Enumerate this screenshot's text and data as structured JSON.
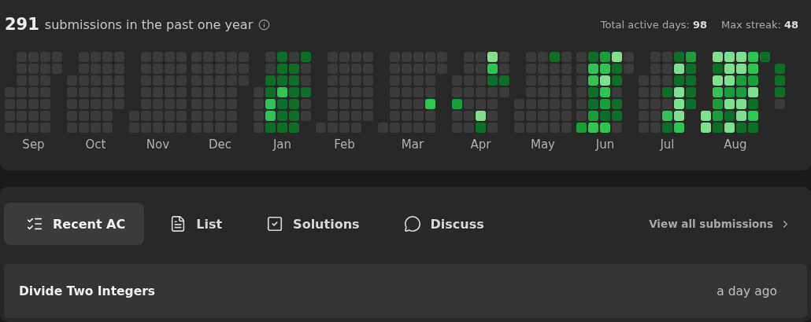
{
  "heatmap": {
    "count": "291",
    "caption": "submissions in the past one year",
    "stats": [
      {
        "label": "Total active days:",
        "value": "98"
      },
      {
        "label": "Max streak:",
        "value": "48"
      }
    ],
    "months": [
      {
        "label": "Sep",
        "weeks": [
          [
            {
              "kind": "gap"
            },
            {
              "kind": "gap"
            },
            {
              "kind": "gap"
            },
            {
              "color": "#3b3b3b"
            },
            {
              "color": "#3b3b3b"
            },
            {
              "color": "#3b3b3b"
            },
            {
              "color": "#3b3b3b"
            }
          ],
          [
            {
              "color": "#3b3b3b"
            },
            {
              "color": "#3b3b3b"
            },
            {
              "color": "#3b3b3b"
            },
            {
              "color": "#3b3b3b"
            },
            {
              "color": "#3b3b3b"
            },
            {
              "color": "#3b3b3b"
            },
            {
              "color": "#3b3b3b"
            }
          ],
          [
            {
              "color": "#3b3b3b"
            },
            {
              "color": "#3b3b3b"
            },
            {
              "color": "#3b3b3b"
            },
            {
              "color": "#3b3b3b"
            },
            {
              "color": "#3b3b3b"
            },
            {
              "color": "#3b3b3b"
            },
            {
              "color": "#3b3b3b"
            }
          ],
          [
            {
              "color": "#3b3b3b"
            },
            {
              "color": "#3b3b3b"
            },
            {
              "color": "#3b3b3b"
            },
            {
              "color": "#3b3b3b"
            },
            {
              "color": "#3b3b3b"
            },
            {
              "color": "#3b3b3b"
            },
            {
              "color": "#3b3b3b"
            }
          ],
          [
            {
              "color": "#3b3b3b"
            },
            {
              "color": "#3b3b3b"
            }
          ]
        ]
      },
      {
        "label": "Oct",
        "weeks": [
          [
            {
              "kind": "gap"
            },
            {
              "kind": "gap"
            },
            {
              "color": "#3b3b3b"
            },
            {
              "color": "#3b3b3b"
            },
            {
              "color": "#3b3b3b"
            },
            {
              "color": "#3b3b3b"
            },
            {
              "color": "#3b3b3b"
            }
          ],
          [
            {
              "color": "#3b3b3b"
            },
            {
              "color": "#3b3b3b"
            },
            {
              "color": "#3b3b3b"
            },
            {
              "color": "#3b3b3b"
            },
            {
              "color": "#3b3b3b"
            },
            {
              "color": "#3b3b3b"
            },
            {
              "color": "#3b3b3b"
            }
          ],
          [
            {
              "color": "#3b3b3b"
            },
            {
              "color": "#3b3b3b"
            },
            {
              "color": "#3b3b3b"
            },
            {
              "color": "#3b3b3b"
            },
            {
              "color": "#3b3b3b"
            },
            {
              "color": "#3b3b3b"
            },
            {
              "color": "#3b3b3b"
            }
          ],
          [
            {
              "color": "#3b3b3b"
            },
            {
              "color": "#3b3b3b"
            },
            {
              "color": "#3b3b3b"
            },
            {
              "color": "#3b3b3b"
            },
            {
              "color": "#3b3b3b"
            },
            {
              "color": "#3b3b3b"
            },
            {
              "color": "#3b3b3b"
            }
          ],
          [
            {
              "color": "#3b3b3b"
            },
            {
              "color": "#3b3b3b"
            },
            {
              "color": "#3b3b3b"
            },
            {
              "color": "#3b3b3b"
            },
            {
              "color": "#3b3b3b"
            }
          ]
        ]
      },
      {
        "label": "Nov",
        "weeks": [
          [
            {
              "kind": "gap"
            },
            {
              "kind": "gap"
            },
            {
              "kind": "gap"
            },
            {
              "kind": "gap"
            },
            {
              "kind": "gap"
            },
            {
              "color": "#3b3b3b"
            },
            {
              "color": "#3b3b3b"
            }
          ],
          [
            {
              "color": "#3b3b3b"
            },
            {
              "color": "#3b3b3b"
            },
            {
              "color": "#3b3b3b"
            },
            {
              "color": "#3b3b3b"
            },
            {
              "color": "#3b3b3b"
            },
            {
              "color": "#3b3b3b"
            },
            {
              "color": "#3b3b3b"
            }
          ],
          [
            {
              "color": "#3b3b3b"
            },
            {
              "color": "#3b3b3b"
            },
            {
              "color": "#3b3b3b"
            },
            {
              "color": "#3b3b3b"
            },
            {
              "color": "#3b3b3b"
            },
            {
              "color": "#3b3b3b"
            },
            {
              "color": "#3b3b3b"
            }
          ],
          [
            {
              "color": "#3b3b3b"
            },
            {
              "color": "#3b3b3b"
            },
            {
              "color": "#3b3b3b"
            },
            {
              "color": "#3b3b3b"
            },
            {
              "color": "#3b3b3b"
            },
            {
              "color": "#3b3b3b"
            },
            {
              "color": "#3b3b3b"
            }
          ],
          [
            {
              "color": "#3b3b3b"
            },
            {
              "color": "#3b3b3b"
            },
            {
              "color": "#3b3b3b"
            },
            {
              "color": "#3b3b3b"
            },
            {
              "color": "#3b3b3b"
            },
            {
              "color": "#3b3b3b"
            },
            {
              "color": "#3b3b3b"
            }
          ]
        ]
      },
      {
        "label": "Dec",
        "weeks": [
          [
            {
              "color": "#3b3b3b"
            },
            {
              "color": "#3b3b3b"
            },
            {
              "color": "#3b3b3b"
            },
            {
              "color": "#3b3b3b"
            },
            {
              "color": "#3b3b3b"
            },
            {
              "color": "#3b3b3b"
            },
            {
              "color": "#3b3b3b"
            }
          ],
          [
            {
              "color": "#3b3b3b"
            },
            {
              "color": "#3b3b3b"
            },
            {
              "color": "#3b3b3b"
            },
            {
              "color": "#3b3b3b"
            },
            {
              "color": "#3b3b3b"
            },
            {
              "color": "#3b3b3b"
            },
            {
              "color": "#3b3b3b"
            }
          ],
          [
            {
              "color": "#3b3b3b"
            },
            {
              "color": "#3b3b3b"
            },
            {
              "color": "#3b3b3b"
            },
            {
              "color": "#3b3b3b"
            },
            {
              "color": "#3b3b3b"
            },
            {
              "color": "#3b3b3b"
            },
            {
              "color": "#3b3b3b"
            }
          ],
          [
            {
              "color": "#3b3b3b"
            },
            {
              "color": "#3b3b3b"
            },
            {
              "color": "#3b3b3b"
            },
            {
              "color": "#3b3b3b"
            },
            {
              "color": "#3b3b3b"
            },
            {
              "color": "#3b3b3b"
            },
            {
              "color": "#3b3b3b"
            }
          ],
          [
            {
              "color": "#3b3b3b"
            },
            {
              "color": "#3b3b3b"
            },
            {
              "color": "#3b3b3b"
            }
          ]
        ]
      },
      {
        "label": "Jan",
        "weeks": [
          [
            {
              "kind": "gap"
            },
            {
              "kind": "gap"
            },
            {
              "kind": "gap"
            },
            {
              "color": "#3b3b3b"
            },
            {
              "color": "#3b3b3b"
            },
            {
              "color": "#3b3b3b"
            },
            {
              "color": "#3b3b3b"
            }
          ],
          [
            {
              "color": "#3b3b3b"
            },
            {
              "color": "#3b3b3b"
            },
            {
              "color": "#0d6e27"
            },
            {
              "color": "#0d6e27"
            },
            {
              "color": "#2fc453"
            },
            {
              "color": "#2fc453"
            },
            {
              "color": "#0d6e27"
            }
          ],
          [
            {
              "color": "#0d6e27"
            },
            {
              "color": "#0d6e27"
            },
            {
              "color": "#0d6e27"
            },
            {
              "color": "#2fc453"
            },
            {
              "color": "#0d6e27"
            },
            {
              "color": "#0d6e27"
            },
            {
              "color": "#0d6e27"
            }
          ],
          [
            {
              "color": "#3b3b3b"
            },
            {
              "color": "#0d6e27"
            },
            {
              "color": "#0d6e27"
            },
            {
              "color": "#0d6e27"
            },
            {
              "color": "#0d6e27"
            },
            {
              "color": "#0d6e27"
            },
            {
              "color": "#0d6e27"
            }
          ],
          [
            {
              "color": "#0d6e27"
            },
            {
              "color": "#3b3b3b"
            },
            {
              "color": "#3b3b3b"
            },
            {
              "color": "#0d6e27"
            },
            {
              "color": "#3b3b3b"
            },
            {
              "color": "#3b3b3b"
            }
          ]
        ]
      },
      {
        "label": "Feb",
        "weeks": [
          [
            {
              "kind": "gap"
            },
            {
              "kind": "gap"
            },
            {
              "kind": "gap"
            },
            {
              "kind": "gap"
            },
            {
              "kind": "gap"
            },
            {
              "kind": "gap"
            },
            {
              "color": "#3b3b3b"
            }
          ],
          [
            {
              "color": "#3b3b3b"
            },
            {
              "color": "#3b3b3b"
            },
            {
              "color": "#3b3b3b"
            },
            {
              "color": "#3b3b3b"
            },
            {
              "color": "#3b3b3b"
            },
            {
              "color": "#3b3b3b"
            },
            {
              "color": "#3b3b3b"
            }
          ],
          [
            {
              "color": "#3b3b3b"
            },
            {
              "color": "#3b3b3b"
            },
            {
              "color": "#3b3b3b"
            },
            {
              "color": "#3b3b3b"
            },
            {
              "color": "#3b3b3b"
            },
            {
              "color": "#3b3b3b"
            },
            {
              "color": "#3b3b3b"
            }
          ],
          [
            {
              "color": "#3b3b3b"
            },
            {
              "color": "#3b3b3b"
            },
            {
              "color": "#3b3b3b"
            },
            {
              "color": "#3b3b3b"
            },
            {
              "color": "#3b3b3b"
            },
            {
              "color": "#3b3b3b"
            },
            {
              "color": "#3b3b3b"
            }
          ],
          [
            {
              "color": "#3b3b3b"
            },
            {
              "color": "#3b3b3b"
            },
            {
              "color": "#3b3b3b"
            },
            {
              "color": "#3b3b3b"
            },
            {
              "color": "#3b3b3b"
            },
            {
              "color": "#3b3b3b"
            }
          ]
        ]
      },
      {
        "label": "Mar",
        "weeks": [
          [
            {
              "kind": "gap"
            },
            {
              "kind": "gap"
            },
            {
              "kind": "gap"
            },
            {
              "kind": "gap"
            },
            {
              "kind": "gap"
            },
            {
              "kind": "gap"
            },
            {
              "color": "#3b3b3b"
            }
          ],
          [
            {
              "color": "#3b3b3b"
            },
            {
              "color": "#3b3b3b"
            },
            {
              "color": "#3b3b3b"
            },
            {
              "color": "#3b3b3b"
            },
            {
              "color": "#3b3b3b"
            },
            {
              "color": "#3b3b3b"
            },
            {
              "color": "#3b3b3b"
            }
          ],
          [
            {
              "color": "#3b3b3b"
            },
            {
              "color": "#3b3b3b"
            },
            {
              "color": "#3b3b3b"
            },
            {
              "color": "#3b3b3b"
            },
            {
              "color": "#3b3b3b"
            },
            {
              "color": "#3b3b3b"
            },
            {
              "color": "#3b3b3b"
            }
          ],
          [
            {
              "color": "#3b3b3b"
            },
            {
              "color": "#3b3b3b"
            },
            {
              "color": "#3b3b3b"
            },
            {
              "color": "#3b3b3b"
            },
            {
              "color": "#3b3b3b"
            },
            {
              "color": "#3b3b3b"
            },
            {
              "color": "#3b3b3b"
            }
          ],
          [
            {
              "color": "#3b3b3b"
            },
            {
              "color": "#3b3b3b"
            },
            {
              "color": "#3b3b3b"
            },
            {
              "color": "#3b3b3b"
            },
            {
              "color": "#2fc453"
            },
            {
              "color": "#3b3b3b"
            },
            {
              "color": "#3b3b3b"
            }
          ],
          [
            {
              "color": "#3b3b3b"
            },
            {
              "color": "#3b3b3b"
            }
          ]
        ]
      },
      {
        "label": "Apr",
        "weeks": [
          [
            {
              "kind": "gap"
            },
            {
              "kind": "gap"
            },
            {
              "color": "#3b3b3b"
            },
            {
              "color": "#3b3b3b"
            },
            {
              "color": "#17a03a"
            },
            {
              "color": "#3b3b3b"
            },
            {
              "color": "#3b3b3b"
            }
          ],
          [
            {
              "color": "#3b3b3b"
            },
            {
              "color": "#3b3b3b"
            },
            {
              "color": "#3b3b3b"
            },
            {
              "color": "#3b3b3b"
            },
            {
              "color": "#3b3b3b"
            },
            {
              "color": "#3b3b3b"
            },
            {
              "color": "#3b3b3b"
            }
          ],
          [
            {
              "color": "#3b3b3b"
            },
            {
              "color": "#3b3b3b"
            },
            {
              "color": "#3b3b3b"
            },
            {
              "color": "#3b3b3b"
            },
            {
              "color": "#3b3b3b"
            },
            {
              "color": "#7fe08f"
            },
            {
              "color": "#0d6e27"
            }
          ],
          [
            {
              "color": "#7fe08f"
            },
            {
              "color": "#2fc453"
            },
            {
              "color": "#0d6e27"
            },
            {
              "color": "#3b3b3b"
            },
            {
              "color": "#3b3b3b"
            },
            {
              "color": "#3b3b3b"
            },
            {
              "color": "#3b3b3b"
            }
          ],
          [
            {
              "color": "#3b3b3b"
            },
            {
              "color": "#3b3b3b"
            },
            {
              "color": "#0d6e27"
            },
            {
              "color": "#3b3b3b"
            }
          ]
        ]
      },
      {
        "label": "May",
        "weeks": [
          [
            {
              "kind": "gap"
            },
            {
              "kind": "gap"
            },
            {
              "kind": "gap"
            },
            {
              "kind": "gap"
            },
            {
              "color": "#3b3b3b"
            },
            {
              "color": "#3b3b3b"
            },
            {
              "color": "#3b3b3b"
            }
          ],
          [
            {
              "color": "#3b3b3b"
            },
            {
              "color": "#3b3b3b"
            },
            {
              "color": "#3b3b3b"
            },
            {
              "color": "#3b3b3b"
            },
            {
              "color": "#3b3b3b"
            },
            {
              "color": "#3b3b3b"
            },
            {
              "color": "#3b3b3b"
            }
          ],
          [
            {
              "color": "#3b3b3b"
            },
            {
              "color": "#3b3b3b"
            },
            {
              "color": "#3b3b3b"
            },
            {
              "color": "#3b3b3b"
            },
            {
              "color": "#3b3b3b"
            },
            {
              "color": "#3b3b3b"
            },
            {
              "color": "#3b3b3b"
            }
          ],
          [
            {
              "color": "#0d6e27"
            },
            {
              "color": "#3b3b3b"
            },
            {
              "color": "#3b3b3b"
            },
            {
              "color": "#3b3b3b"
            },
            {
              "color": "#3b3b3b"
            },
            {
              "color": "#3b3b3b"
            },
            {
              "color": "#3b3b3b"
            }
          ],
          [
            {
              "color": "#3b3b3b"
            },
            {
              "color": "#3b3b3b"
            },
            {
              "color": "#3b3b3b"
            },
            {
              "color": "#3b3b3b"
            },
            {
              "color": "#3b3b3b"
            },
            {
              "color": "#3b3b3b"
            },
            {
              "color": "#3b3b3b"
            }
          ]
        ]
      },
      {
        "label": "Jun",
        "weeks": [
          [
            {
              "color": "#3b3b3b"
            },
            {
              "color": "#3b3b3b"
            },
            {
              "color": "#3b3b3b"
            },
            {
              "color": "#3b3b3b"
            },
            {
              "color": "#3b3b3b"
            },
            {
              "color": "#3b3b3b"
            },
            {
              "color": "#17a03a"
            }
          ],
          [
            {
              "color": "#0d6e27"
            },
            {
              "color": "#2fc453"
            },
            {
              "color": "#2fc453"
            },
            {
              "color": "#0d6e27"
            },
            {
              "color": "#0d6e27"
            },
            {
              "color": "#17a03a"
            },
            {
              "color": "#2fc453"
            }
          ],
          [
            {
              "color": "#17a03a"
            },
            {
              "color": "#2fc453"
            },
            {
              "color": "#7fe08f"
            },
            {
              "color": "#2fc453"
            },
            {
              "color": "#17a03a"
            },
            {
              "color": "#0d6e27"
            },
            {
              "color": "#2fc453"
            }
          ],
          [
            {
              "color": "#7fe08f"
            },
            {
              "color": "#0d6e27"
            },
            {
              "color": "#0d6e27"
            },
            {
              "color": "#3b3b3b"
            },
            {
              "color": "#0d6e27"
            },
            {
              "color": "#0d6e27"
            },
            {
              "color": "#3b3b3b"
            }
          ],
          [
            {
              "color": "#3b3b3b"
            },
            {
              "color": "#3b3b3b"
            }
          ]
        ]
      },
      {
        "label": "Jul",
        "weeks": [
          [
            {
              "kind": "gap"
            },
            {
              "kind": "gap"
            },
            {
              "color": "#3b3b3b"
            },
            {
              "color": "#3b3b3b"
            },
            {
              "color": "#3b3b3b"
            },
            {
              "color": "#3b3b3b"
            },
            {
              "color": "#3b3b3b"
            }
          ],
          [
            {
              "color": "#3b3b3b"
            },
            {
              "color": "#3b3b3b"
            },
            {
              "color": "#3b3b3b"
            },
            {
              "color": "#3b3b3b"
            },
            {
              "color": "#3b3b3b"
            },
            {
              "color": "#3b3b3b"
            },
            {
              "color": "#3b3b3b"
            }
          ],
          [
            {
              "color": "#3b3b3b"
            },
            {
              "color": "#3b3b3b"
            },
            {
              "color": "#3b3b3b"
            },
            {
              "color": "#0d6e27"
            },
            {
              "color": "#3b3b3b"
            },
            {
              "color": "#2fc453"
            },
            {
              "color": "#0d6e27"
            }
          ],
          [
            {
              "color": "#0d6e27"
            },
            {
              "color": "#7fe08f"
            },
            {
              "color": "#0d6e27"
            },
            {
              "color": "#7fe08f"
            },
            {
              "color": "#7fe08f"
            },
            {
              "color": "#7fe08f"
            },
            {
              "color": "#2fc453"
            }
          ],
          [
            {
              "color": "#17a03a"
            },
            {
              "color": "#0d6e27"
            },
            {
              "color": "#0d6e27"
            },
            {
              "color": "#0d6e27"
            },
            {
              "color": "#0d6e27"
            }
          ]
        ]
      },
      {
        "label": "Aug",
        "weeks": [
          [
            {
              "kind": "gap"
            },
            {
              "kind": "gap"
            },
            {
              "kind": "gap"
            },
            {
              "kind": "gap"
            },
            {
              "kind": "gap"
            },
            {
              "color": "#7fe08f"
            },
            {
              "color": "#7fe08f"
            }
          ],
          [
            {
              "color": "#7fe08f"
            },
            {
              "color": "#0d6e27"
            },
            {
              "color": "#7fe08f"
            },
            {
              "color": "#2fc453"
            },
            {
              "color": "#17a03a"
            },
            {
              "color": "#17a03a"
            },
            {
              "color": "#0d6e27"
            }
          ],
          [
            {
              "color": "#7fe08f"
            },
            {
              "color": "#7fe08f"
            },
            {
              "color": "#7fe08f"
            },
            {
              "color": "#17a03a"
            },
            {
              "color": "#7fe08f"
            },
            {
              "color": "#0d6e27"
            },
            {
              "color": "#7fe08f"
            }
          ],
          [
            {
              "color": "#7fe08f"
            },
            {
              "color": "#7fe08f"
            },
            {
              "color": "#17a03a"
            },
            {
              "color": "#17a03a"
            },
            {
              "color": "#7fe08f"
            },
            {
              "color": "#7fe08f"
            },
            {
              "color": "#0d6e27"
            }
          ],
          [
            {
              "color": "#2fc453"
            },
            {
              "color": "#2fc453"
            },
            {
              "color": "#17a03a"
            },
            {
              "color": "#7fe08f"
            },
            {
              "color": "#0d6e27"
            },
            {
              "color": "#2fc453"
            },
            {
              "color": "#0d6e27"
            }
          ],
          [
            {
              "color": "#0d6e27"
            }
          ]
        ]
      },
      {
        "weeks": [
          [
            {
              "kind": "gap"
            },
            {
              "color": "#0d6e27"
            },
            {
              "color": "#0d6e27"
            },
            {
              "color": "#0d6e27"
            },
            {
              "color": "#3b3b3b"
            }
          ]
        ]
      }
    ]
  },
  "tabs": [
    {
      "label": "Recent AC",
      "kind": "checklist",
      "selected": true
    },
    {
      "label": "List",
      "kind": "document",
      "selected": false
    },
    {
      "label": "Solutions",
      "kind": "checkbox",
      "selected": false
    },
    {
      "label": "Discuss",
      "kind": "chat",
      "selected": false
    }
  ],
  "view_all": "View all submissions",
  "submissions": [
    {
      "title": "Divide Two Integers",
      "time": "a day ago"
    }
  ]
}
